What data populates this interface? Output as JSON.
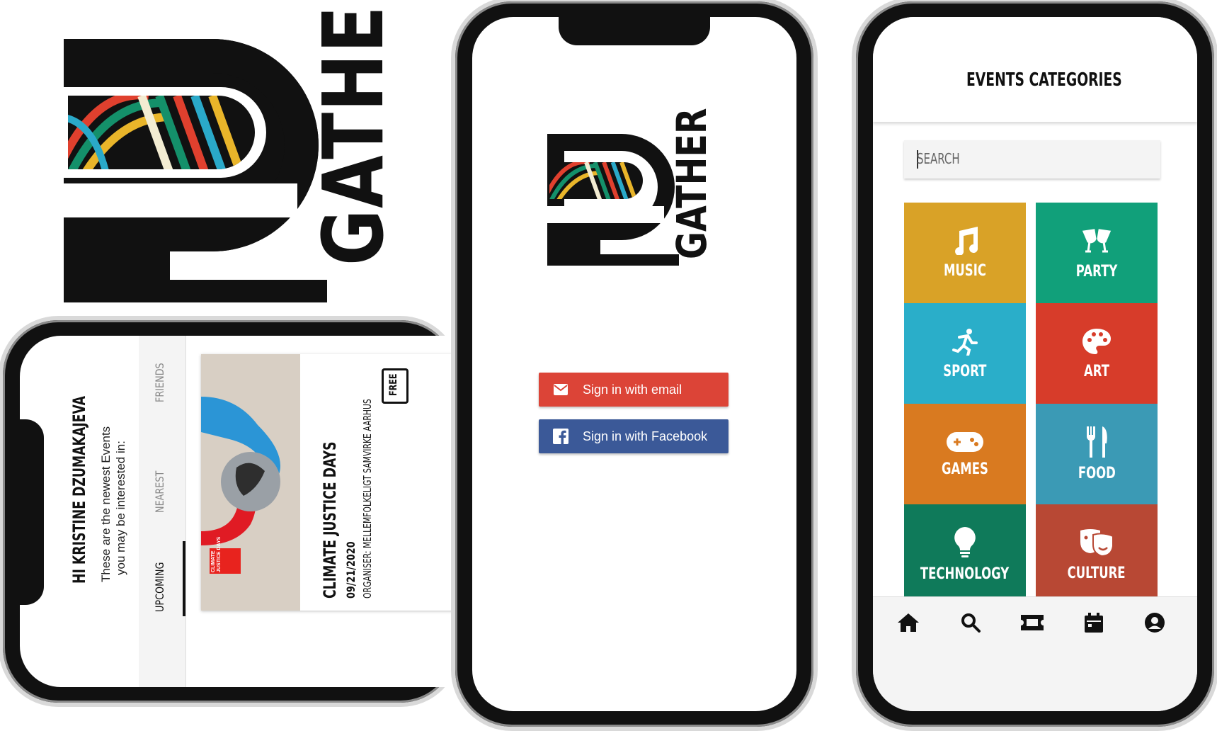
{
  "brand": {
    "name": "GATHER",
    "colors": {
      "red": "#e0402e",
      "green": "#14906a",
      "yellow": "#e9b52a",
      "blue": "#2aa9c9",
      "cream": "#f3ecd2",
      "black": "#111111"
    }
  },
  "login": {
    "email_button": "Sign in with email",
    "facebook_button": "Sign in with Facebook",
    "email_color": "#dc4437",
    "facebook_color": "#3b5998"
  },
  "feed": {
    "greeting": "HI KRISTINE DZUMAKAJEVA",
    "subtitle_line1": "These are the newest Events",
    "subtitle_line2": "you may be interested in:",
    "tabs": [
      {
        "label": "UPCOMING",
        "active": true
      },
      {
        "label": "NEAREST",
        "active": false
      },
      {
        "label": "FRIENDS",
        "active": false
      }
    ],
    "event": {
      "title": "CLIMATE JUSTICE DAYS",
      "date": "09/21/2020",
      "organiser": "ORGANISER: MELLEMFOLKELIGT SAMVIRKE AARHUS",
      "badge": "FREE",
      "poster_text": "CLIMATE JUSTICE DAYS"
    }
  },
  "categories": {
    "title": "EVENTS CATEGORIES",
    "search_placeholder": "SEARCH",
    "items": [
      {
        "label": "MUSIC",
        "icon": "music-note-icon",
        "color": "#d9a227"
      },
      {
        "label": "PARTY",
        "icon": "cheers-icon",
        "color": "#11a07a"
      },
      {
        "label": "SPORT",
        "icon": "running-icon",
        "color": "#2aaec9"
      },
      {
        "label": "ART",
        "icon": "palette-icon",
        "color": "#d73c2a"
      },
      {
        "label": "GAMES",
        "icon": "gamepad-icon",
        "color": "#d97a20"
      },
      {
        "label": "FOOD",
        "icon": "cutlery-icon",
        "color": "#3b9ab5"
      },
      {
        "label": "TECHNOLOGY",
        "icon": "lightbulb-icon",
        "color": "#0f7a5a"
      },
      {
        "label": "CULTURE",
        "icon": "theater-masks-icon",
        "color": "#b84834"
      }
    ],
    "bottom_nav": [
      "home-icon",
      "search-icon",
      "ticket-icon",
      "calendar-icon",
      "profile-icon"
    ]
  }
}
